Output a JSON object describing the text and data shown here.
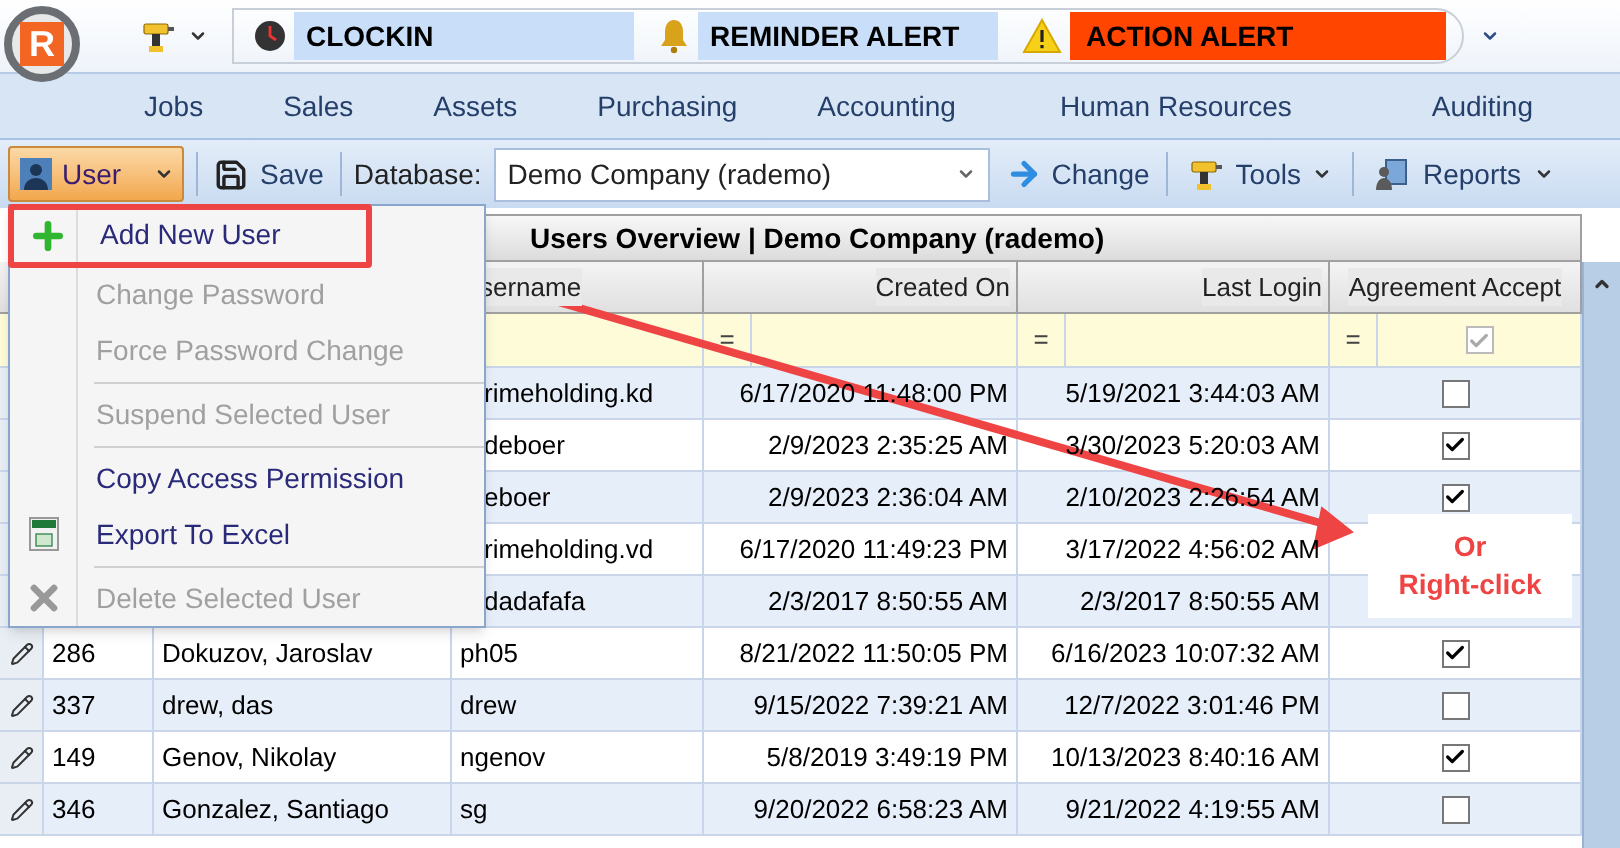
{
  "logo": {
    "letter": "R"
  },
  "quick_access": [
    {
      "kind": "clock",
      "label": "CLOCKIN",
      "color": "#c9def8"
    },
    {
      "kind": "bell",
      "label": "REMINDER ALERT",
      "color": "#c9def8"
    },
    {
      "kind": "warning",
      "label": "ACTION ALERT",
      "color": "#ff4500"
    }
  ],
  "ribbon_tabs": [
    {
      "label": "Jobs"
    },
    {
      "label": "Sales"
    },
    {
      "label": "Assets"
    },
    {
      "label": "Purchasing"
    },
    {
      "label": "Accounting"
    },
    {
      "label": "Human Resources"
    },
    {
      "label": "Auditing"
    }
  ],
  "toolbar": {
    "user_button": {
      "label": "User",
      "expanded": true
    },
    "save_label": "Save",
    "database_label": "Database:",
    "database_value": "Demo Company (rademo)",
    "change_label": "Change",
    "tools_label": "Tools",
    "reports_label": "Reports"
  },
  "user_menu": [
    {
      "kind": "add",
      "label": "Add New User",
      "disabled": false,
      "highlighted": true
    },
    {
      "kind": "plain",
      "label": "Change Password",
      "disabled": true
    },
    {
      "kind": "plain",
      "label": "Force Password Change",
      "disabled": true
    },
    {
      "kind": "separator"
    },
    {
      "kind": "plain",
      "label": "Suspend Selected User",
      "disabled": true
    },
    {
      "kind": "separator"
    },
    {
      "kind": "plain",
      "label": "Copy Access Permission",
      "disabled": false
    },
    {
      "kind": "export",
      "label": "Export To Excel",
      "disabled": false
    },
    {
      "kind": "separator"
    },
    {
      "kind": "delete",
      "label": "Delete Selected User",
      "disabled": true
    }
  ],
  "table": {
    "title": "Users Overview | Demo Company (rademo)",
    "columns": [
      "sername",
      "Created On",
      "Last Login",
      "Agreement Accept"
    ],
    "filters": [
      {
        "operator": "="
      },
      {
        "operator": "="
      },
      {
        "operator": "=",
        "checked": true
      }
    ],
    "rows": [
      {
        "username": "rimeholding.kd",
        "created_on": "6/17/2020 11:48:00 PM",
        "last_login": "5/19/2021 3:44:03 AM",
        "agreement_accept": false
      },
      {
        "username": "deboer",
        "created_on": "2/9/2023 2:35:25 AM",
        "last_login": "3/30/2023 5:20:03 AM",
        "agreement_accept": true
      },
      {
        "username": "eboer",
        "created_on": "2/9/2023 2:36:04 AM",
        "last_login": "2/10/2023 2:26:54 AM",
        "agreement_accept": true
      },
      {
        "username": "rimeholding.vd",
        "created_on": "6/17/2020 11:49:23 PM",
        "last_login": "3/17/2022 4:56:02 AM"
      },
      {
        "username": "dadafafa",
        "created_on": "2/3/2017 8:50:55 AM",
        "last_login": "2/3/2017 8:50:55 AM"
      },
      {
        "id": "286",
        "name": "Dokuzov, Jaroslav",
        "username": "ph05",
        "created_on": "8/21/2022 11:50:05 PM",
        "last_login": "6/16/2023 10:07:32 AM",
        "agreement_accept": true
      },
      {
        "id": "337",
        "name": "drew, das",
        "username": "drew",
        "created_on": "9/15/2022 7:39:21 AM",
        "last_login": "12/7/2022 3:01:46 PM",
        "agreement_accept": false
      },
      {
        "id": "149",
        "name": "Genov, Nikolay",
        "username": "ngenov",
        "created_on": "5/8/2019 3:49:19 PM",
        "last_login": "10/13/2023 8:40:16 AM",
        "agreement_accept": true
      },
      {
        "id": "346",
        "name": "Gonzalez, Santiago",
        "username": "sg",
        "created_on": "9/20/2022 6:58:23 AM",
        "last_login": "9/21/2022 4:19:55 AM",
        "agreement_accept": false
      }
    ]
  },
  "callout": {
    "lines": [
      "Or",
      "Right-click"
    ]
  }
}
